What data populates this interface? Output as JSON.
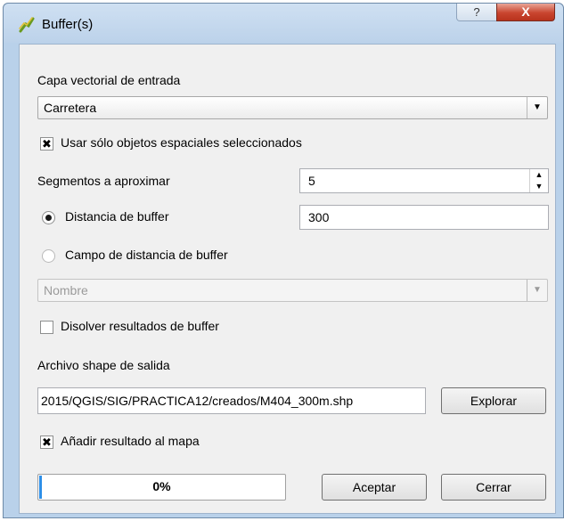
{
  "window": {
    "title": "Buffer(s)"
  },
  "title_buttons": {
    "help": "?",
    "close": "X"
  },
  "input_layer": {
    "label": "Capa vectorial de entrada",
    "value": "Carretera"
  },
  "use_selected": {
    "label": "Usar sólo objetos espaciales seleccionados",
    "checked": true
  },
  "segments": {
    "label": "Segmentos a aproximar",
    "value": "5"
  },
  "buffer_distance": {
    "label": "Distancia de buffer",
    "value": "300",
    "selected": true
  },
  "buffer_field": {
    "label": "Campo de distancia de buffer",
    "selected": false,
    "value": "Nombre"
  },
  "dissolve": {
    "label": "Disolver resultados de buffer",
    "checked": false
  },
  "output": {
    "label": "Archivo shape de salida",
    "value": "2015/QGIS/SIG/PRACTICA12/creados/M404_300m.shp",
    "browse_label": "Explorar"
  },
  "add_to_map": {
    "label": "Añadir resultado al mapa",
    "checked": true
  },
  "progress": {
    "text": "0%",
    "value": 0
  },
  "buttons": {
    "accept": "Aceptar",
    "close": "Cerrar"
  },
  "icons": {
    "app": "qgis-buffer-icon",
    "check": "✖"
  }
}
